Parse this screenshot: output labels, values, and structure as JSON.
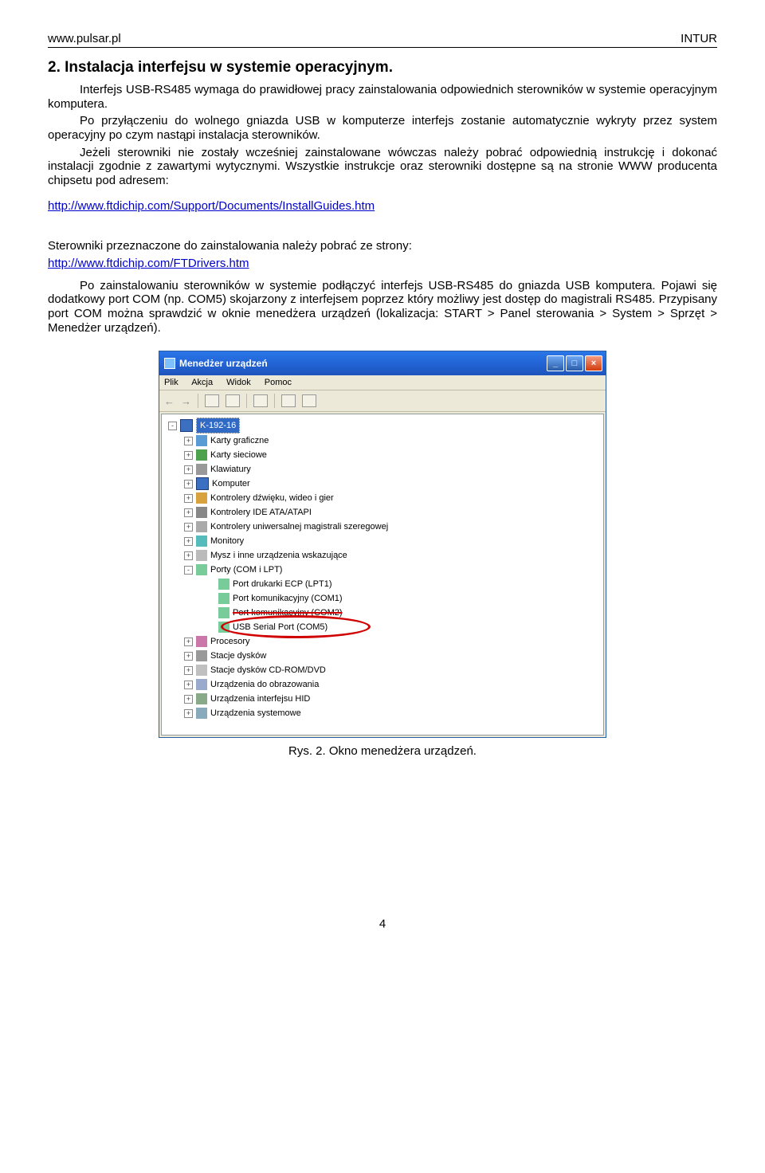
{
  "header": {
    "left": "www.pulsar.pl",
    "right": "INTUR"
  },
  "section_title": "2. Instalacja interfejsu w systemie operacyjnym.",
  "para1": "Interfejs USB-RS485 wymaga do prawidłowej pracy zainstalowania odpowiednich sterowników w systemie operacyjnym komputera.",
  "para2": "Po przyłączeniu do wolnego gniazda USB w komputerze interfejs zostanie automatycznie wykryty przez system operacyjny po czym nastąpi instalacja sterowników.",
  "para3": "Jeżeli sterowniki nie zostały wcześniej zainstalowane wówczas należy pobrać odpowiednią instrukcję i dokonać instalacji zgodnie z zawartymi wytycznymi. Wszystkie instrukcje oraz sterowniki dostępne są na stronie WWW producenta chipsetu pod adresem:",
  "link1": "http://www.ftdichip.com/Support/Documents/InstallGuides.htm",
  "para4": "Sterowniki przeznaczone do zainstalowania należy pobrać ze strony:",
  "link2": "http://www.ftdichip.com/FTDrivers.htm",
  "para5": "Po zainstalowaniu sterowników w systemie podłączyć interfejs USB-RS485 do gniazda USB komputera. Pojawi się dodatkowy port COM (np. COM5) skojarzony z interfejsem poprzez który możliwy jest dostęp do magistrali RS485. Przypisany port COM można sprawdzić w oknie menedżera urządzeń (lokalizacja: START > Panel sterowania > System > Sprzęt > Menedżer urządzeń).",
  "dm": {
    "title": "Menedżer urządzeń",
    "menu": [
      "Plik",
      "Akcja",
      "Widok",
      "Pomoc"
    ],
    "root": "K-192-16",
    "nodes": [
      {
        "l": 1,
        "exp": "+",
        "icon": "display",
        "label": "Karty graficzne"
      },
      {
        "l": 1,
        "exp": "+",
        "icon": "net",
        "label": "Karty sieciowe"
      },
      {
        "l": 1,
        "exp": "+",
        "icon": "kbd",
        "label": "Klawiatury"
      },
      {
        "l": 1,
        "exp": "+",
        "icon": "comp",
        "label": "Komputer"
      },
      {
        "l": 1,
        "exp": "+",
        "icon": "sound",
        "label": "Kontrolery dźwięku, wideo i gier"
      },
      {
        "l": 1,
        "exp": "+",
        "icon": "ide",
        "label": "Kontrolery IDE ATA/ATAPI"
      },
      {
        "l": 1,
        "exp": "+",
        "icon": "usb",
        "label": "Kontrolery uniwersalnej magistrali szeregowej"
      },
      {
        "l": 1,
        "exp": "+",
        "icon": "monitor",
        "label": "Monitory"
      },
      {
        "l": 1,
        "exp": "+",
        "icon": "mouse",
        "label": "Mysz i inne urządzenia wskazujące"
      },
      {
        "l": 1,
        "exp": "-",
        "icon": "port",
        "label": "Porty (COM i LPT)"
      },
      {
        "l": 2,
        "exp": "",
        "icon": "port",
        "label": "Port drukarki ECP (LPT1)"
      },
      {
        "l": 2,
        "exp": "",
        "icon": "port",
        "label": "Port komunikacyjny (COM1)"
      },
      {
        "l": 2,
        "exp": "",
        "icon": "port",
        "label": "Port komunikacyjny (COM2)",
        "strike": true
      },
      {
        "l": 2,
        "exp": "",
        "icon": "port",
        "label": "USB Serial Port (COM5)",
        "hl": true
      },
      {
        "l": 1,
        "exp": "+",
        "icon": "cpu",
        "label": "Procesory"
      },
      {
        "l": 1,
        "exp": "+",
        "icon": "disk",
        "label": "Stacje dysków"
      },
      {
        "l": 1,
        "exp": "+",
        "icon": "cd",
        "label": "Stacje dysków CD-ROM/DVD"
      },
      {
        "l": 1,
        "exp": "+",
        "icon": "img",
        "label": "Urządzenia do obrazowania"
      },
      {
        "l": 1,
        "exp": "+",
        "icon": "hid",
        "label": "Urządzenia interfejsu HID"
      },
      {
        "l": 1,
        "exp": "+",
        "icon": "sys",
        "label": "Urządzenia systemowe"
      }
    ]
  },
  "caption": "Rys. 2. Okno menedżera urządzeń.",
  "page_num": "4"
}
